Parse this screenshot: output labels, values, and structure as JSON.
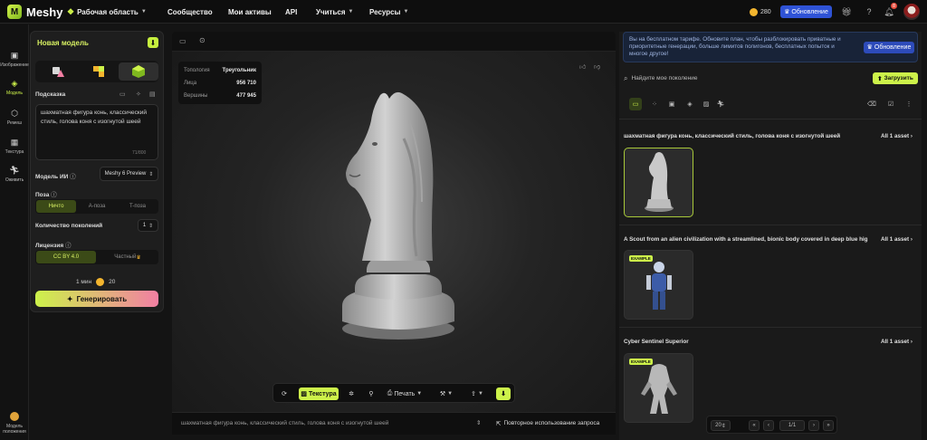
{
  "topbar": {
    "brand": "Meshy",
    "workspace": "Рабочая область",
    "nav": [
      "Сообщество",
      "Мои активы",
      "API",
      "Учиться",
      "Ресурсы"
    ],
    "credits": "280",
    "upgrade": "Обновление",
    "notif_count": "8"
  },
  "rail": {
    "items": [
      "Изображение",
      "Модель",
      "Ремеш",
      "Текстура",
      "Оживить"
    ],
    "bottom": "Модель положения"
  },
  "panel": {
    "title": "Новая модель",
    "prompt_label": "Подсказка",
    "prompt_text": "шахматная фигура конь, классический стиль, голова коня с изогнутой шеей",
    "counter": "71/800",
    "ai_model_label": "Модель ИИ",
    "ai_model_value": "Meshy 6 Preview",
    "pose_label": "Поза",
    "pose_options": [
      "Ничто",
      "A-поза",
      "T-поза"
    ],
    "gen_count_label": "Количество поколений",
    "gen_count_value": "1",
    "license_label": "Лицензия",
    "license_options": [
      "CC BY 4.0",
      "Частный"
    ],
    "time": "1 мин",
    "cost": "20",
    "generate": "Генерировать"
  },
  "viewport": {
    "stats": [
      {
        "k": "Топология",
        "v": "Треугольник"
      },
      {
        "k": "Лица",
        "v": "956 710"
      },
      {
        "k": "Вершины",
        "v": "477 945"
      }
    ],
    "toolbar": {
      "texture": "Текстура",
      "print": "Печать"
    },
    "bottom_prompt": "шахматная фигура конь, классический стиль, голова коня с изогнутой шеей",
    "reuse": "Повторное использование запроса"
  },
  "right": {
    "banner": "Вы на бесплатном тарифе. Обновите план, чтобы разблокировать приватные и приоритетные генерации, больше лимитов полигонов, бесплатных попыток и многое другое!",
    "banner_btn": "Обновление",
    "search_placeholder": "Найдите мое поколение",
    "upload": "Загрузить",
    "all_asset": "All 1 asset",
    "example_tag": "EXAMPLE",
    "groups": [
      "шахматная фигура конь, классический стиль, голова коня с изогнутой шеей",
      "A Scout from an alien civilization with a streamlined, bionic body covered in deep blue hig...",
      "Cyber Sentinel Superior"
    ],
    "page_size": "20",
    "page": "1/1"
  },
  "colors": {
    "accent": "#cdf24a",
    "brand_blue": "#2f53d6"
  }
}
